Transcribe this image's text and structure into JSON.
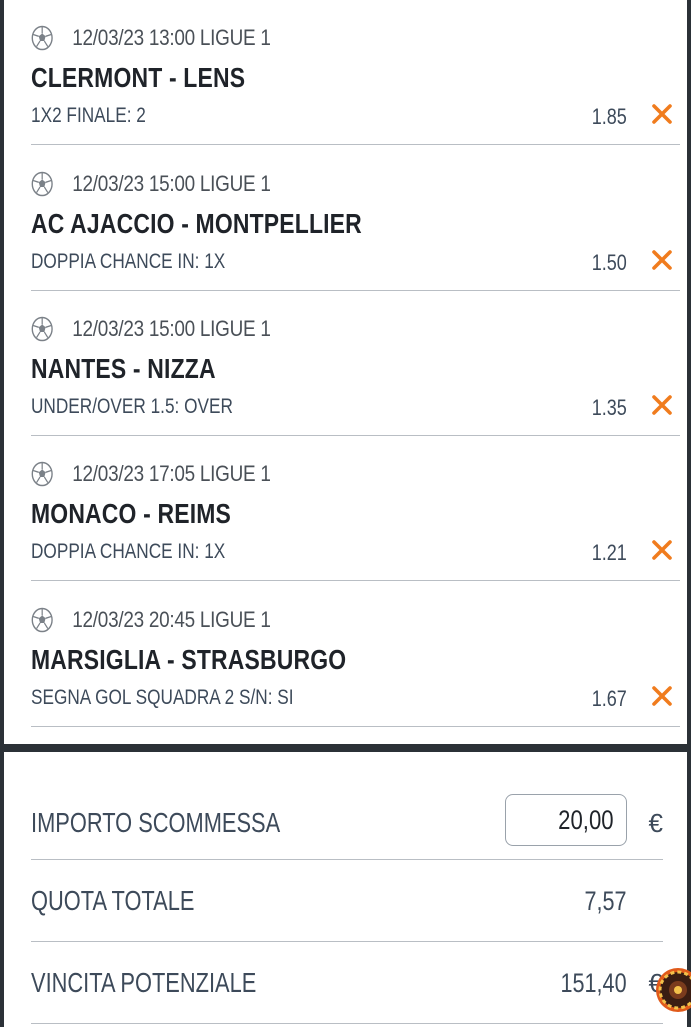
{
  "bets": [
    {
      "meta": "12/03/23 13:00 LIGUE 1",
      "teams": "CLERMONT - LENS",
      "market": "1X2 FINALE: 2",
      "odd": "1.85"
    },
    {
      "meta": "12/03/23 15:00 LIGUE 1",
      "teams": "AC AJACCIO - MONTPELLIER",
      "market": "DOPPIA CHANCE IN: 1X",
      "odd": "1.50"
    },
    {
      "meta": "12/03/23 15:00 LIGUE 1",
      "teams": "NANTES - NIZZA",
      "market": "UNDER/OVER 1.5: OVER",
      "odd": "1.35"
    },
    {
      "meta": "12/03/23 17:05 LIGUE 1",
      "teams": "MONACO - REIMS",
      "market": "DOPPIA CHANCE IN: 1X",
      "odd": "1.21"
    },
    {
      "meta": "12/03/23 20:45 LIGUE 1",
      "teams": "MARSIGLIA - STRASBURGO",
      "market": "SEGNA GOL SQUADRA 2 S/N: SI",
      "odd": "1.67"
    }
  ],
  "summary": {
    "stake_label": "IMPORTO SCOMMESSA",
    "stake_value": "20,00",
    "currency": "€",
    "total_odds_label": "QUOTA TOTALE",
    "total_odds_value": "7,57",
    "potential_win_label": "VINCITA POTENZIALE",
    "potential_win_value": "151,40"
  },
  "icons": {
    "sport": "soccer-ball-icon",
    "remove": "close-icon",
    "corner": "roulette-icon"
  },
  "colors": {
    "accent": "#f07c1e",
    "text": "#3d4a5a",
    "heading": "#1f2329",
    "background": "#2b3137"
  }
}
